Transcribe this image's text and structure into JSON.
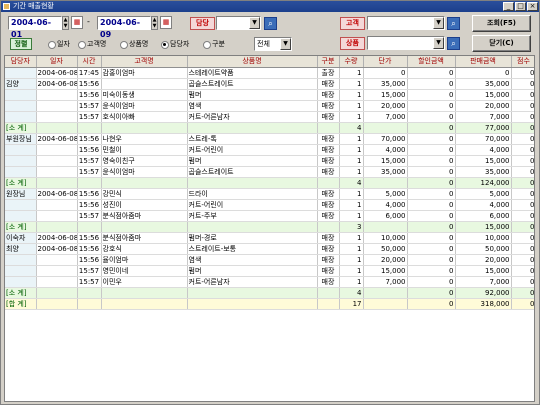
{
  "window": {
    "title": "기간 매출현황"
  },
  "filters": {
    "date_from": "2004-06-01",
    "date_sep": "-",
    "date_to": "2004-06-09",
    "manager_label": "담당",
    "manager_value": "",
    "customer_label": "고객",
    "customer_value": "",
    "product_label": "상품",
    "product_value": "",
    "sort_label": "정렬",
    "sort_options": [
      "일자",
      "고객명",
      "상품명",
      "담당자",
      "구분"
    ],
    "sort_selected": "담당자",
    "type_value": "전체"
  },
  "buttons": {
    "search": "조회(F5)",
    "close": "닫기(C)"
  },
  "columns": [
    "담당자",
    "일자",
    "시간",
    "고객명",
    "상품명",
    "구분",
    "수량",
    "단가",
    "할인금액",
    "판매금액",
    "점수"
  ],
  "rows": [
    {
      "t": "d",
      "c": [
        "",
        "2004-06-08",
        "17:45",
        "감홍이엄마",
        "스테레이트약품",
        "출장",
        "1",
        "0",
        "0",
        "0",
        "0"
      ]
    },
    {
      "t": "d",
      "c": [
        "김양",
        "2004-06-08",
        "15:56",
        "",
        "곱슬스트레이트",
        "매장",
        "1",
        "35,000",
        "0",
        "35,000",
        "0"
      ]
    },
    {
      "t": "d",
      "c": [
        "",
        "",
        "15:56",
        "미숙이동생",
        "펌머",
        "매장",
        "1",
        "15,000",
        "0",
        "15,000",
        "0"
      ]
    },
    {
      "t": "d",
      "c": [
        "",
        "",
        "15:57",
        "윤식이엄마",
        "염색",
        "매장",
        "1",
        "20,000",
        "0",
        "20,000",
        "0"
      ]
    },
    {
      "t": "d",
      "c": [
        "",
        "",
        "15:57",
        "호식이아빠",
        "커트-어른남자",
        "매장",
        "1",
        "7,000",
        "0",
        "7,000",
        "0"
      ]
    },
    {
      "t": "s",
      "c": [
        "[소 계]",
        "",
        "",
        "",
        "",
        "",
        "4",
        "",
        "0",
        "77,000",
        "0"
      ]
    },
    {
      "t": "d",
      "c": [
        "부원장님",
        "2004-06-08",
        "15:56",
        "나현우",
        "스트레-톡",
        "매장",
        "1",
        "70,000",
        "0",
        "70,000",
        "0"
      ]
    },
    {
      "t": "d",
      "c": [
        "",
        "",
        "15:56",
        "민철이",
        "커트-어린이",
        "매장",
        "1",
        "4,000",
        "0",
        "4,000",
        "0"
      ]
    },
    {
      "t": "d",
      "c": [
        "",
        "",
        "15:57",
        "영숙이친구",
        "펌머",
        "매장",
        "1",
        "15,000",
        "0",
        "15,000",
        "0"
      ]
    },
    {
      "t": "d",
      "c": [
        "",
        "",
        "15:57",
        "윤식이엄마",
        "곱슬스트레이트",
        "매장",
        "1",
        "35,000",
        "0",
        "35,000",
        "0"
      ]
    },
    {
      "t": "s",
      "c": [
        "[소 계]",
        "",
        "",
        "",
        "",
        "",
        "4",
        "",
        "0",
        "124,000",
        "0"
      ]
    },
    {
      "t": "d",
      "c": [
        "원장님",
        "2004-06-08",
        "15:56",
        "강민식",
        "드라이",
        "매장",
        "1",
        "5,000",
        "0",
        "5,000",
        "0"
      ]
    },
    {
      "t": "d",
      "c": [
        "",
        "",
        "15:56",
        "성진이",
        "커트-어린이",
        "매장",
        "1",
        "4,000",
        "0",
        "4,000",
        "0"
      ]
    },
    {
      "t": "d",
      "c": [
        "",
        "",
        "15:57",
        "분식점아줌마",
        "커트-주부",
        "매장",
        "1",
        "6,000",
        "0",
        "6,000",
        "0"
      ]
    },
    {
      "t": "s",
      "c": [
        "[소 계]",
        "",
        "",
        "",
        "",
        "",
        "3",
        "",
        "0",
        "15,000",
        "0"
      ]
    },
    {
      "t": "d",
      "c": [
        "이숙자",
        "2004-06-08",
        "15:56",
        "분식점아줌마",
        "펌머-경로",
        "매장",
        "1",
        "10,000",
        "0",
        "10,000",
        "0"
      ]
    },
    {
      "t": "d",
      "c": [
        "최양",
        "2004-06-08",
        "15:56",
        "강호식",
        "스트레이트-보통",
        "매장",
        "1",
        "50,000",
        "0",
        "50,000",
        "0"
      ]
    },
    {
      "t": "d",
      "c": [
        "",
        "",
        "15:56",
        "율이엄마",
        "염색",
        "매장",
        "1",
        "20,000",
        "0",
        "20,000",
        "0"
      ]
    },
    {
      "t": "d",
      "c": [
        "",
        "",
        "15:57",
        "영민이네",
        "펌머",
        "매장",
        "1",
        "15,000",
        "0",
        "15,000",
        "0"
      ]
    },
    {
      "t": "d",
      "c": [
        "",
        "",
        "15:57",
        "이민우",
        "커트-어른남자",
        "매장",
        "1",
        "7,000",
        "0",
        "7,000",
        "0"
      ]
    },
    {
      "t": "s",
      "c": [
        "[소 계]",
        "",
        "",
        "",
        "",
        "",
        "4",
        "",
        "0",
        "92,000",
        "0"
      ]
    },
    {
      "t": "g",
      "c": [
        "[합 계]",
        "",
        "",
        "",
        "",
        "",
        "17",
        "",
        "0",
        "318,000",
        "0"
      ]
    }
  ]
}
